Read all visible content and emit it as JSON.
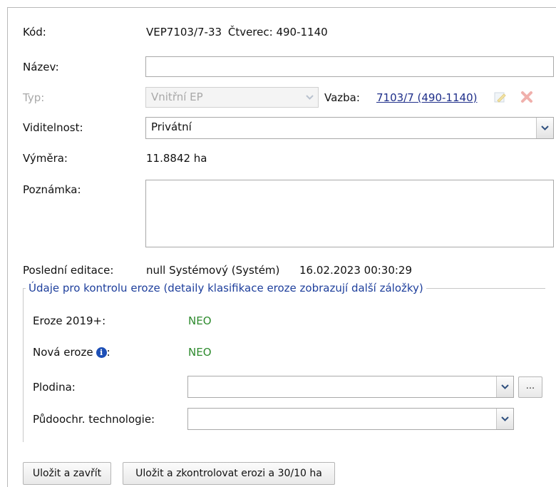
{
  "fields": {
    "kod_label": "Kód:",
    "kod_value": "VEP7103/7-33",
    "ctverec_label": "Čtverec:",
    "ctverec_value": "490-1140",
    "nazev_label": "Název:",
    "nazev_value": "",
    "typ_label": "Typ:",
    "typ_value": "Vnitřní EP",
    "vazba_label": "Vazba:",
    "vazba_link": "7103/7 (490-1140)",
    "viditelnost_label": "Viditelnost:",
    "viditelnost_value": "Privátní",
    "vymera_label": "Výměra:",
    "vymera_value": "11.8842 ha",
    "poznamka_label": "Poznámka:",
    "poznamka_value": "",
    "posledni_label": "Poslední editace:",
    "posledni_user": "null Systémový (Systém)",
    "posledni_date": "16.02.2023 00:30:29"
  },
  "erosion": {
    "legend": "Údaje pro kontrolu eroze (detaily klasifikace eroze zobrazují další záložky)",
    "eroze_label": "Eroze 2019+:",
    "eroze_value": "NEO",
    "nova_label": "Nová eroze",
    "nova_colon": ":",
    "nova_value": "NEO",
    "plodina_label": "Plodina:",
    "plodina_value": "",
    "plodina_more": "...",
    "technologie_label": "Půdoochr. technologie:",
    "technologie_value": ""
  },
  "buttons": {
    "save_close": "Uložit a zavřít",
    "save_check": "Uložit a zkontrolovat erozi a 30/10 ha"
  },
  "icons": {
    "info": "i",
    "edit": "edit-note-icon",
    "delete": "delete-x-icon",
    "dropdown": "chevron-down-icon"
  },
  "colors": {
    "green_value": "#2e8b2e",
    "legend_blue": "#1e3f9c",
    "link_blue": "#1f2f8a"
  }
}
